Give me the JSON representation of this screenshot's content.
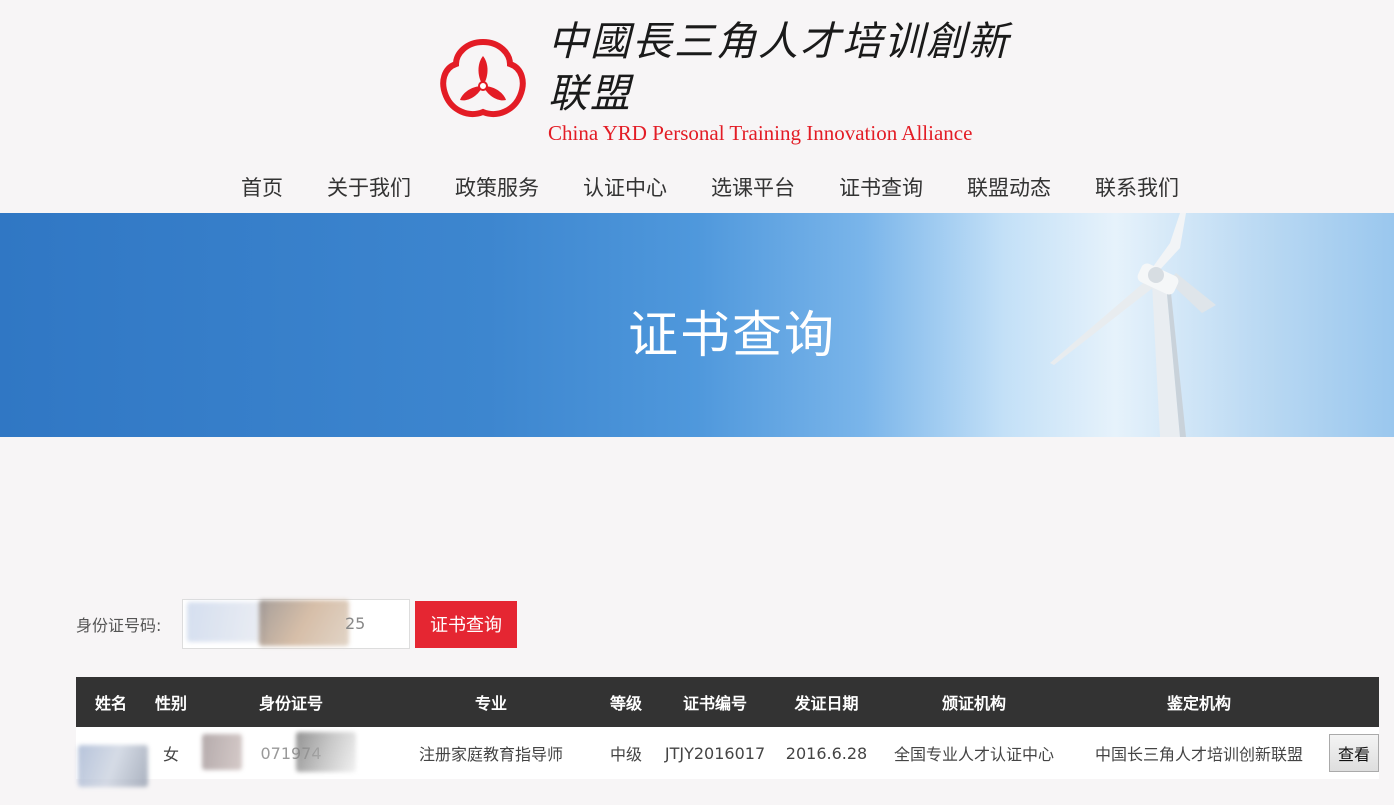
{
  "brand": {
    "name_cn": "中國長三角人才培训創新联盟",
    "name_en": "China  YRD Personal Training Innovation Alliance",
    "accent": "#e31c25"
  },
  "nav": {
    "items": [
      "首页",
      "关于我们",
      "政策服务",
      "认证中心",
      "选课平台",
      "证书查询",
      "联盟动态",
      "联系我们"
    ]
  },
  "banner": {
    "title": "证书查询"
  },
  "search": {
    "label": "身份证号码:",
    "value_visible": "25",
    "button_label": "证书查询",
    "button_color": "#e52632"
  },
  "table": {
    "headers": [
      "姓名",
      "性别",
      "身份证号",
      "专业",
      "等级",
      "证书编号",
      "发证日期",
      "颁证机构",
      "鉴定机构"
    ],
    "rows": [
      {
        "name": "",
        "gender": "女",
        "id_number": "071974",
        "major": "注册家庭教育指导师",
        "level": "中级",
        "cert_no": "JTJY2016017",
        "issue_date": "2016.6.28",
        "issuer": "全国专业人才认证中心",
        "appraiser": "中国长三角人才培训创新联盟",
        "action_label": "查看"
      }
    ]
  }
}
